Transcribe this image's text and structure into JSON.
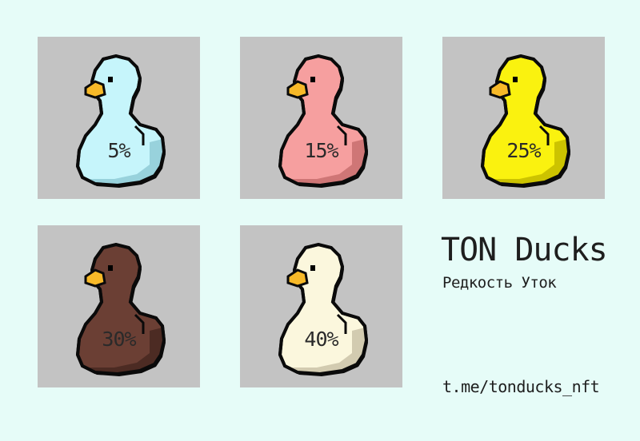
{
  "colors": {
    "background": "#e6fcf8",
    "card": "#c3c3c3",
    "outline": "#0a0a0a",
    "beak": "#f7b928",
    "eye": "#000000"
  },
  "ducks": [
    {
      "label": "5%",
      "body_color": "#c6f5fb",
      "shade_color": "#98d2dc"
    },
    {
      "label": "15%",
      "body_color": "#f69f9f",
      "shade_color": "#cf7676"
    },
    {
      "label": "25%",
      "body_color": "#faf20f",
      "shade_color": "#ccc300"
    },
    {
      "label": "30%",
      "body_color": "#6b3f34",
      "shade_color": "#4c2b23"
    },
    {
      "label": "40%",
      "body_color": "#fbf7dd",
      "shade_color": "#d2cbb0"
    }
  ],
  "info": {
    "title": "TON Ducks",
    "subtitle": "Редкость Уток",
    "link": "t.me/tonducks_nft"
  }
}
